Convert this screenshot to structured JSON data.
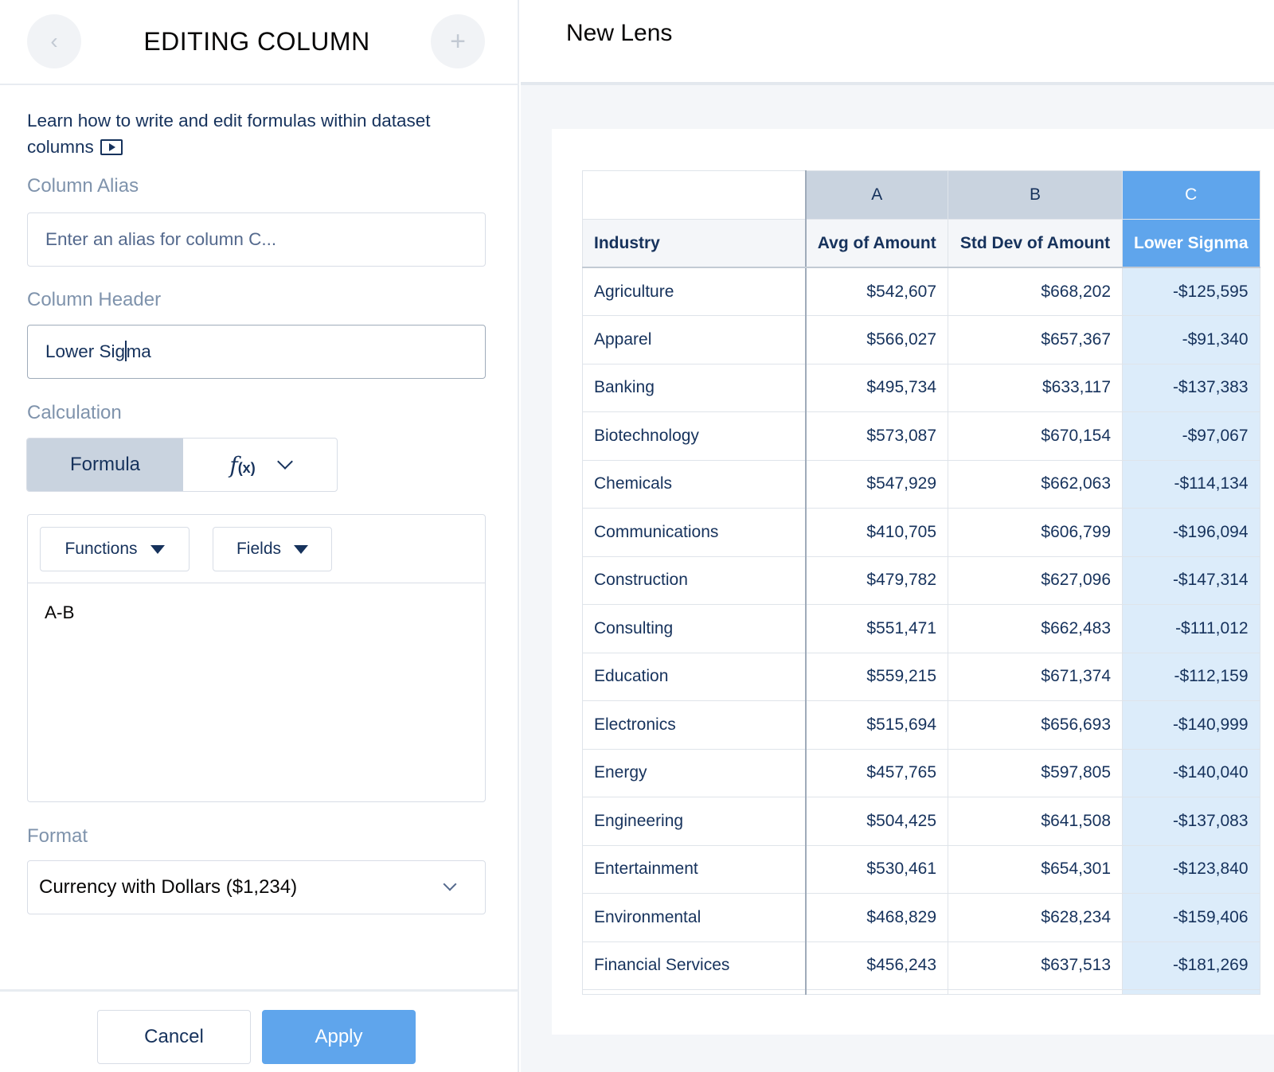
{
  "panel": {
    "title": "EDITING COLUMN",
    "back_icon": "‹",
    "add_icon": "+",
    "help_text": "Learn how to write and edit formulas within dataset columns",
    "alias_label": "Column Alias",
    "alias_placeholder": "Enter an alias for column C...",
    "header_label": "Column Header",
    "header_value_before_caret": "Lower Sig",
    "header_value_after_caret": "ma",
    "calc_label": "Calculation",
    "calc_mode": "Formula",
    "fx_symbol": "f",
    "fx_args": "(x)",
    "functions_btn": "Functions",
    "fields_btn": "Fields",
    "formula": "A-B",
    "format_label": "Format",
    "format_value": "Currency with Dollars ($1,234)",
    "cancel": "Cancel",
    "apply": "Apply"
  },
  "lens": {
    "title": "New Lens"
  },
  "table": {
    "letters": [
      "A",
      "B",
      "C"
    ],
    "headers": [
      "Industry",
      "Avg of Amount",
      "Std Dev of Amount",
      "Lower Signma"
    ],
    "rows": [
      [
        "Agriculture",
        "$542,607",
        "$668,202",
        "-$125,595"
      ],
      [
        "Apparel",
        "$566,027",
        "$657,367",
        "-$91,340"
      ],
      [
        "Banking",
        "$495,734",
        "$633,117",
        "-$137,383"
      ],
      [
        "Biotechnology",
        "$573,087",
        "$670,154",
        "-$97,067"
      ],
      [
        "Chemicals",
        "$547,929",
        "$662,063",
        "-$114,134"
      ],
      [
        "Communications",
        "$410,705",
        "$606,799",
        "-$196,094"
      ],
      [
        "Construction",
        "$479,782",
        "$627,096",
        "-$147,314"
      ],
      [
        "Consulting",
        "$551,471",
        "$662,483",
        "-$111,012"
      ],
      [
        "Education",
        "$559,215",
        "$671,374",
        "-$112,159"
      ],
      [
        "Electronics",
        "$515,694",
        "$656,693",
        "-$140,999"
      ],
      [
        "Energy",
        "$457,765",
        "$597,805",
        "-$140,040"
      ],
      [
        "Engineering",
        "$504,425",
        "$641,508",
        "-$137,083"
      ],
      [
        "Entertainment",
        "$530,461",
        "$654,301",
        "-$123,840"
      ],
      [
        "Environmental",
        "$468,829",
        "$628,234",
        "-$159,406"
      ],
      [
        "Financial Services",
        "$456,243",
        "$637,513",
        "-$181,269"
      ]
    ]
  },
  "colors": {
    "accent": "#5fa5ec",
    "active_column_bg": "#dcecfa",
    "column_letter_bg": "#c9d3df",
    "text": "#16325c"
  }
}
